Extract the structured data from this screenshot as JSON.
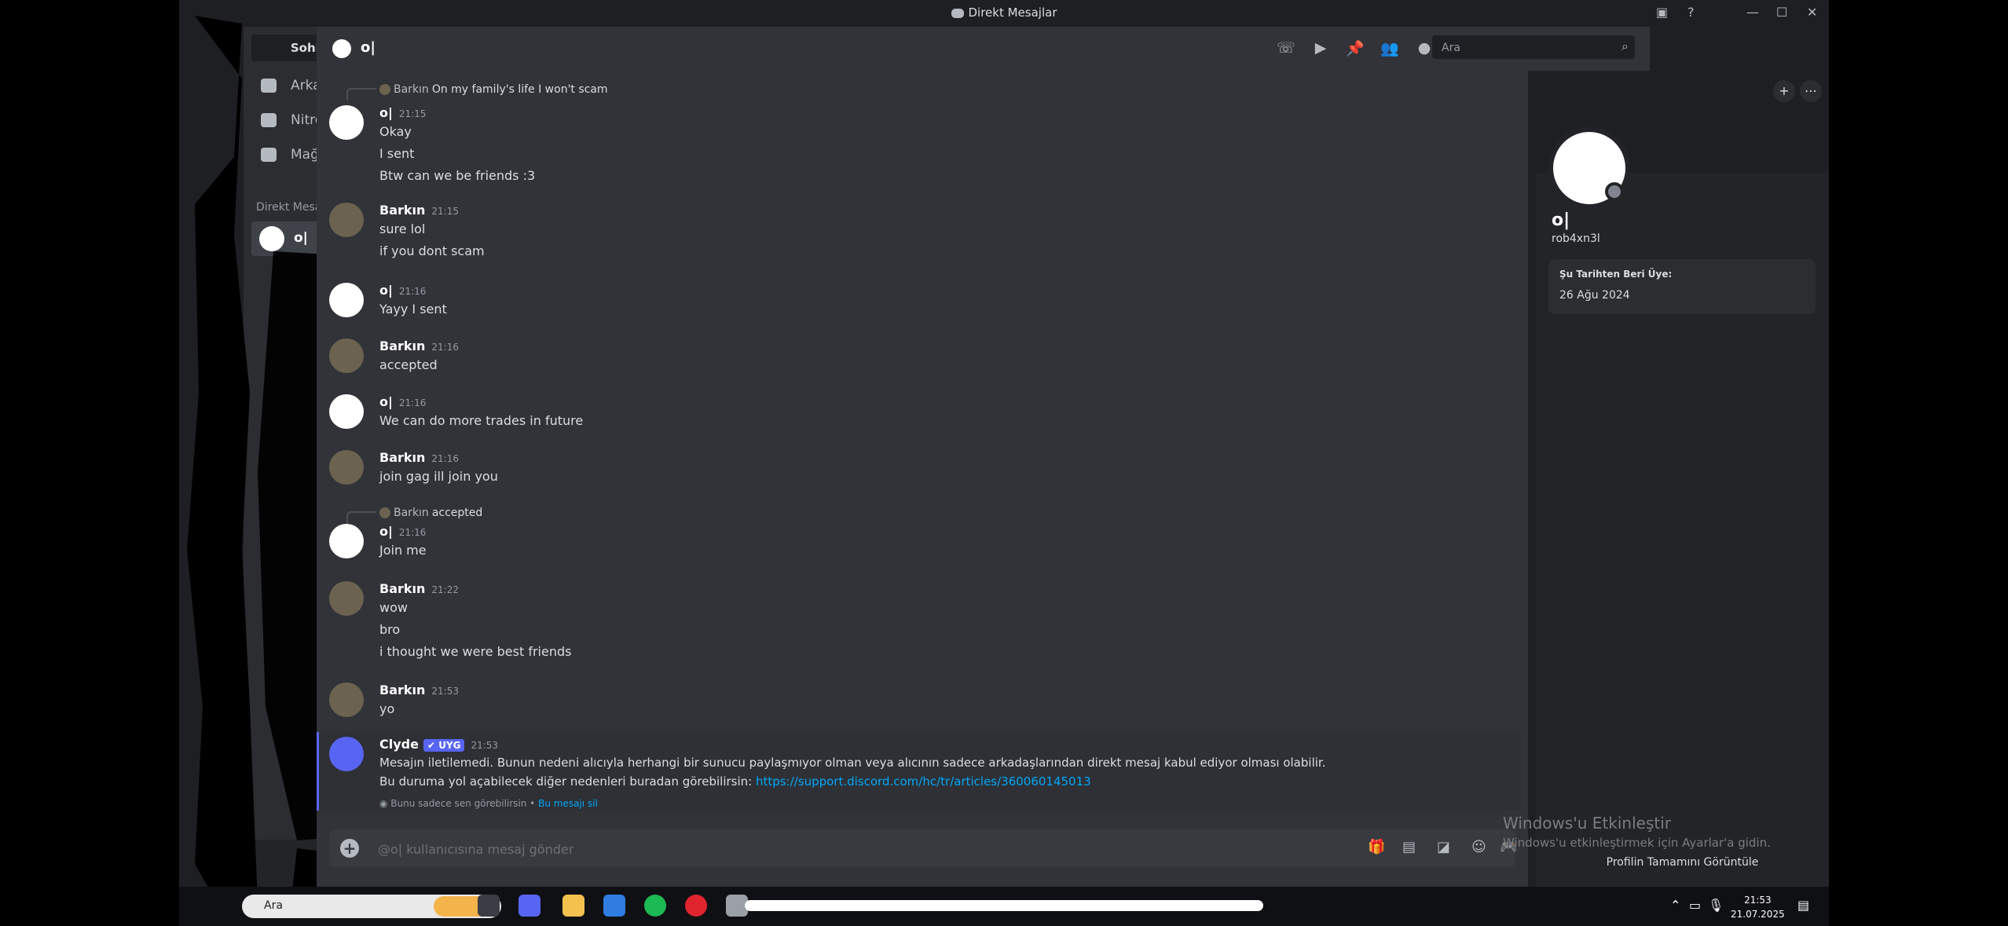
{
  "window": {
    "title": "Direkt Mesajlar"
  },
  "sidebar": {
    "find_button": "Sohbet bul ya da başlat",
    "nav": [
      {
        "label": "Arkadaşlar",
        "icon": "friends-icon"
      },
      {
        "label": "Nitro",
        "icon": "nitro-icon"
      },
      {
        "label": "Mağaza",
        "icon": "shop-icon"
      }
    ],
    "dm_header": "Direkt Mesajlar",
    "dm_add": "+",
    "dm_items": [
      {
        "label": "o|"
      }
    ]
  },
  "header": {
    "channel_name": "o|",
    "search_placeholder": "Ara"
  },
  "messages": [
    {
      "reply_name": "Barkın",
      "reply_text": "On my family's life I won't scam",
      "author": "o|",
      "time": "21:15",
      "lines": [
        "Okay",
        "I sent",
        "Btw can we be friends :3"
      ]
    },
    {
      "author": "Barkın",
      "time": "21:15",
      "lines": [
        "sure lol",
        "if you dont scam"
      ]
    },
    {
      "author": "o|",
      "time": "21:16",
      "lines": [
        "Yayy I sent"
      ]
    },
    {
      "author": "Barkın",
      "time": "21:16",
      "lines": [
        "accepted"
      ]
    },
    {
      "author": "o|",
      "time": "21:16",
      "lines": [
        "We can do more trades in future"
      ]
    },
    {
      "author": "Barkın",
      "time": "21:16",
      "lines": [
        "join gag ill join you"
      ]
    },
    {
      "reply_name": "Barkın",
      "reply_text": "accepted",
      "author": "o|",
      "time": "21:16",
      "lines": [
        "Join me"
      ]
    },
    {
      "author": "Barkın",
      "time": "21:22",
      "lines": [
        "wow",
        "bro",
        "i thought we were best friends"
      ]
    },
    {
      "author": "Barkın",
      "time": "21:53",
      "lines": [
        "yo"
      ]
    }
  ],
  "clyde": {
    "author": "Clyde",
    "badge": "✔ UYG",
    "time": "21:53",
    "line1": "Mesajın iletilemedi. Bunun nedeni alıcıyla herhangi bir sunucu paylaşmıyor olman veya alıcının sadece arkadaşlarından direkt mesaj kabul ediyor olması olabilir.",
    "line2": "Bu duruma yol açabilecek diğer nedenleri buradan görebilirsin:",
    "link": "https://support.discord.com/hc/tr/articles/360060145013",
    "footer_text": "Bunu sadece sen görebilirsin •",
    "footer_link": "Bu mesajı sil"
  },
  "composer": {
    "placeholder": "@o| kullanıcısına mesaj gönder"
  },
  "profile": {
    "display_name": "o|",
    "username": "rob4xn3l",
    "member_since_label": "Şu Tarihten Beri Üye:",
    "member_since": "26 Ağu 2024",
    "view_full": "Profilin Tamamını Görüntüle"
  },
  "watermark": {
    "title": "Windows'u Etkinleştir",
    "subtitle": "Windows'u etkinleştirmek için Ayarlar'a gidin."
  },
  "taskbar": {
    "search": "Ara",
    "time": "21:53",
    "date": "21.07.2025"
  },
  "colors": {
    "accent": "#5865f2",
    "link": "#00a8fc",
    "danger": "#f23f43"
  }
}
